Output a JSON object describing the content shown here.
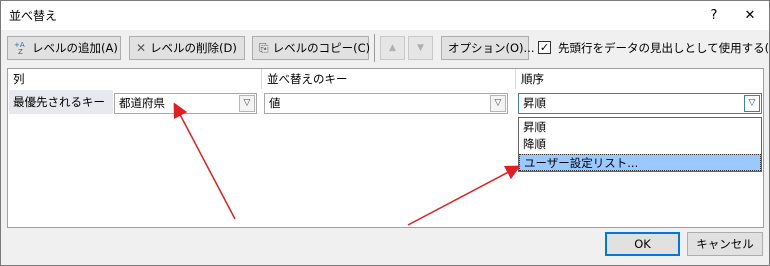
{
  "window": {
    "title": "並べ替え",
    "help_glyph": "?",
    "close_glyph": "✕"
  },
  "toolbar": {
    "add_level": "レベルの追加(A)",
    "delete_level": "レベルの削除(D)",
    "copy_level": "レベルのコピー(C)",
    "move_up_glyph": "▲",
    "move_down_glyph": "▼",
    "options": "オプション(O)...",
    "header_checkbox_label": "先頭行をデータの見出しとして使用する(H)",
    "header_checkbox_checked": true,
    "check_glyph": "✓"
  },
  "grid": {
    "headers": {
      "column": "列",
      "sort_on": "並べ替えのキー",
      "order": "順序"
    },
    "row": {
      "label": "最優先されるキー",
      "column_value": "都道府県",
      "sort_on_value": "値",
      "order_value": "昇順"
    }
  },
  "order_dropdown": {
    "options": [
      "昇順",
      "降順",
      "ユーザー設定リスト..."
    ],
    "selected_index": 2
  },
  "footer": {
    "ok": "OK",
    "cancel": "キャンセル"
  },
  "colors": {
    "annotation_arrow": "#e02020",
    "selection": "#99c9ff",
    "focus": "#3c7fb1"
  }
}
